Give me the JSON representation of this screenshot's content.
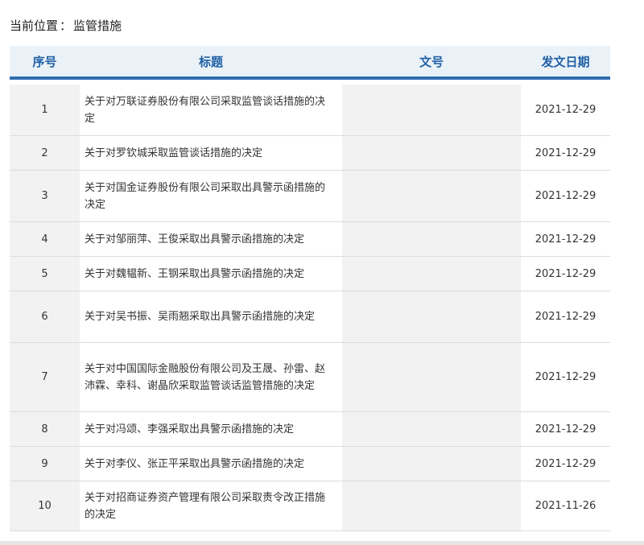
{
  "breadcrumb": {
    "prefix": "当前位置",
    "separator": "：",
    "current": "监管措施"
  },
  "table": {
    "headers": {
      "no": "序号",
      "title": "标题",
      "doc_no": "文号",
      "date": "发文日期"
    },
    "rows": [
      {
        "no": "1",
        "title": "关于对万联证券股份有限公司采取监管谈话措施的决定",
        "doc_no": "",
        "date": "2021-12-29"
      },
      {
        "no": "2",
        "title": "关于对罗钦城采取监管谈话措施的决定",
        "doc_no": "",
        "date": "2021-12-29"
      },
      {
        "no": "3",
        "title": "关于对国金证券股份有限公司采取出具警示函措施的决定",
        "doc_no": "",
        "date": "2021-12-29"
      },
      {
        "no": "4",
        "title": "关于对邹丽萍、王俊采取出具警示函措施的决定",
        "doc_no": "",
        "date": "2021-12-29"
      },
      {
        "no": "5",
        "title": "关于对魏韫新、王钢采取出具警示函措施的决定",
        "doc_no": "",
        "date": "2021-12-29"
      },
      {
        "no": "6",
        "title": "关于对吴书振、吴雨翘采取出具警示函措施的决定",
        "doc_no": "",
        "date": "2021-12-29"
      },
      {
        "no": "7",
        "title": "关于对中国国际金融股份有限公司及王晟、孙雷、赵沛霖、幸科、谢晶欣采取监管谈话监管措施的决定",
        "doc_no": "",
        "date": "2021-12-29"
      },
      {
        "no": "8",
        "title": "关于对冯颂、李强采取出具警示函措施的决定",
        "doc_no": "",
        "date": "2021-12-29"
      },
      {
        "no": "9",
        "title": "关于对李仪、张正平采取出具警示函措施的决定",
        "doc_no": "",
        "date": "2021-12-29"
      },
      {
        "no": "10",
        "title": "关于对招商证券资产管理有限公司采取责令改正措施的决定",
        "doc_no": "",
        "date": "2021-11-26"
      }
    ]
  }
}
